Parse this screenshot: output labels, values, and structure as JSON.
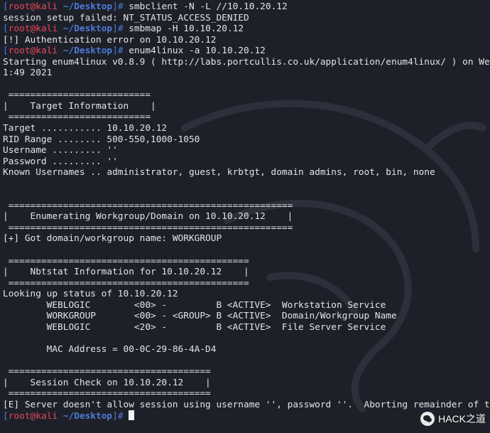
{
  "prompt": {
    "user": "root@kali",
    "path": "~/Desktop",
    "open_bracket": "[",
    "close_bracket": "]",
    "symbol": "# "
  },
  "lines": [
    {
      "type": "prompt",
      "cmd": "smbclient -N -L //10.10.20.12"
    },
    {
      "type": "text",
      "text": "session setup failed: NT_STATUS_ACCESS_DENIED"
    },
    {
      "type": "prompt",
      "cmd": "smbmap -H 10.10.20.12"
    },
    {
      "type": "text",
      "text": "[!] Authentication error on 10.10.20.12"
    },
    {
      "type": "prompt",
      "cmd": "enum4linux -a 10.10.20.12"
    },
    {
      "type": "text",
      "text": "Starting enum4linux v0.8.9 ( http://labs.portcullis.co.uk/application/enum4linux/ ) on We"
    },
    {
      "type": "text",
      "text": "1:49 2021"
    },
    {
      "type": "text",
      "text": ""
    },
    {
      "type": "text",
      "text": " =========================="
    },
    {
      "type": "text",
      "text": "|    Target Information    |"
    },
    {
      "type": "text",
      "text": " =========================="
    },
    {
      "type": "text",
      "text": "Target ........... 10.10.20.12"
    },
    {
      "type": "text",
      "text": "RID Range ........ 500-550,1000-1050"
    },
    {
      "type": "text",
      "text": "Username ......... ''"
    },
    {
      "type": "text",
      "text": "Password ......... ''"
    },
    {
      "type": "text",
      "text": "Known Usernames .. administrator, guest, krbtgt, domain admins, root, bin, none"
    },
    {
      "type": "text",
      "text": ""
    },
    {
      "type": "text",
      "text": ""
    },
    {
      "type": "text",
      "text": " ===================================================="
    },
    {
      "type": "text",
      "text": "|    Enumerating Workgroup/Domain on 10.10.20.12    |"
    },
    {
      "type": "text",
      "text": " ===================================================="
    },
    {
      "type": "text",
      "text": "[+] Got domain/workgroup name: WORKGROUP"
    },
    {
      "type": "text",
      "text": ""
    },
    {
      "type": "text",
      "text": " ============================================"
    },
    {
      "type": "text",
      "text": "|    Nbtstat Information for 10.10.20.12    |"
    },
    {
      "type": "text",
      "text": " ============================================"
    },
    {
      "type": "text",
      "text": "Looking up status of 10.10.20.12"
    },
    {
      "type": "text",
      "text": "        WEBLOGIC        <00> -         B <ACTIVE>  Workstation Service"
    },
    {
      "type": "text",
      "text": "        WORKGROUP       <00> - <GROUP> B <ACTIVE>  Domain/Workgroup Name"
    },
    {
      "type": "text",
      "text": "        WEBLOGIC        <20> -         B <ACTIVE>  File Server Service"
    },
    {
      "type": "text",
      "text": ""
    },
    {
      "type": "text",
      "text": "        MAC Address = 00-0C-29-86-4A-D4"
    },
    {
      "type": "text",
      "text": ""
    },
    {
      "type": "text",
      "text": " ====================================="
    },
    {
      "type": "text",
      "text": "|    Session Check on 10.10.20.12    |"
    },
    {
      "type": "text",
      "text": " ====================================="
    },
    {
      "type": "text",
      "text": "[E] Server doesn't allow session using username '', password ''.  Aborting remainder of t"
    },
    {
      "type": "prompt",
      "cmd": "",
      "cursor": true
    }
  ],
  "watermark": {
    "text": "HACK之道"
  },
  "colors": {
    "background": "#1e2029",
    "prompt_user": "#e8485a",
    "prompt_path": "#4b7bd6",
    "text": "#e4e4e4"
  }
}
